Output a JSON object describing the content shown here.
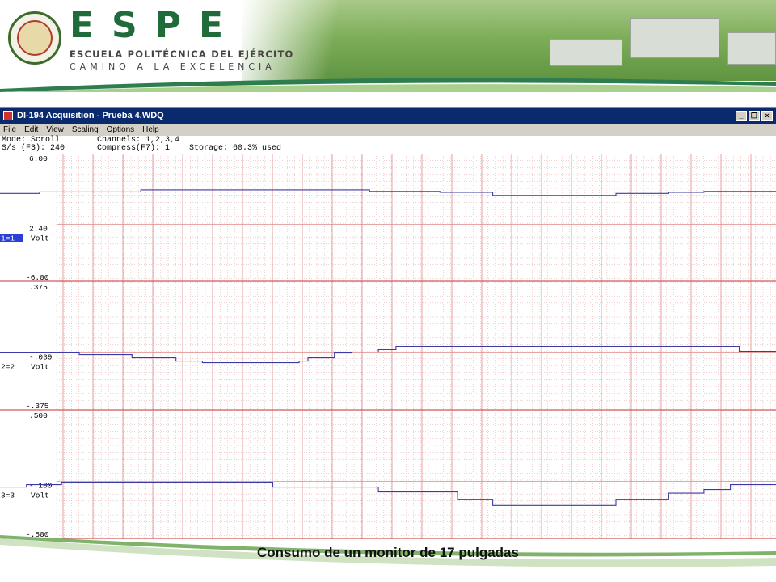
{
  "header": {
    "brand": "ESPE",
    "subtitle": "ESCUELA POLITÉCNICA DEL EJÉRCITO",
    "motto": "CAMINO A LA EXCELENCIA",
    "accent": "#1f6b3a"
  },
  "window": {
    "title": "DI-194 Acquisition - Prueba 4.WDQ",
    "menu": [
      "File",
      "Edit",
      "View",
      "Scaling",
      "Options",
      "Help"
    ],
    "status_line1_left": "Mode: Scroll",
    "status_line1_right": "Channels: 1,2,3,4",
    "status_line2_left": "S/s (F3): 240",
    "status_line2_mid": "Compress(F7): 1",
    "status_line2_right": "Storage: 60.3% used"
  },
  "channels": [
    {
      "label": "1=1",
      "unit": "Volt",
      "top": "6.00",
      "mid": "2.40",
      "bottom": "-6.00",
      "selected": true
    },
    {
      "label": "2=2",
      "unit": "Volt",
      "top": ".375",
      "mid": "-.039",
      "bottom": "-.375",
      "selected": false
    },
    {
      "label": "3=3",
      "unit": "Volt",
      "top": ".500",
      "mid": "-.100",
      "bottom": "-.500",
      "selected": false
    }
  ],
  "caption": "Consumo de un monitor de 17 pulgadas",
  "chart_data": {
    "type": "line",
    "title": "",
    "series": [
      {
        "channel": "1=1",
        "ylim": [
          -6.0,
          6.0
        ],
        "color": "#3b3ba8",
        "x": [
          0,
          40,
          45,
          150,
          160,
          410,
          420,
          490,
          500,
          540,
          560,
          610,
          640,
          700,
          760,
          800,
          880
        ],
        "values": [
          2.4,
          2.4,
          2.55,
          2.55,
          2.75,
          2.75,
          2.6,
          2.6,
          2.5,
          2.5,
          2.2,
          2.2,
          2.2,
          2.4,
          2.5,
          2.6,
          2.6
        ]
      },
      {
        "channel": "2=2",
        "ylim": [
          -0.375,
          0.375
        ],
        "color": "#3b3ba8",
        "x": [
          0,
          80,
          90,
          140,
          150,
          190,
          200,
          230,
          280,
          300,
          340,
          350,
          360,
          380,
          400,
          430,
          450,
          640,
          700,
          830,
          840,
          880
        ],
        "values": [
          -0.039,
          -0.039,
          -0.05,
          -0.05,
          -0.07,
          -0.07,
          -0.09,
          -0.1,
          -0.1,
          -0.1,
          -0.09,
          -0.07,
          -0.07,
          -0.04,
          -0.035,
          -0.02,
          0.0,
          0.0,
          0.0,
          0.0,
          -0.03,
          -0.03
        ]
      },
      {
        "channel": "3=3",
        "ylim": [
          -0.5,
          0.5
        ],
        "color": "#3b3ba8",
        "x": [
          0,
          30,
          70,
          300,
          310,
          420,
          430,
          520,
          560,
          640,
          700,
          760,
          800,
          830,
          880
        ],
        "values": [
          -0.1,
          -0.08,
          -0.06,
          -0.06,
          -0.1,
          -0.1,
          -0.14,
          -0.2,
          -0.25,
          -0.25,
          -0.2,
          -0.15,
          -0.12,
          -0.08,
          -0.08
        ]
      }
    ]
  }
}
